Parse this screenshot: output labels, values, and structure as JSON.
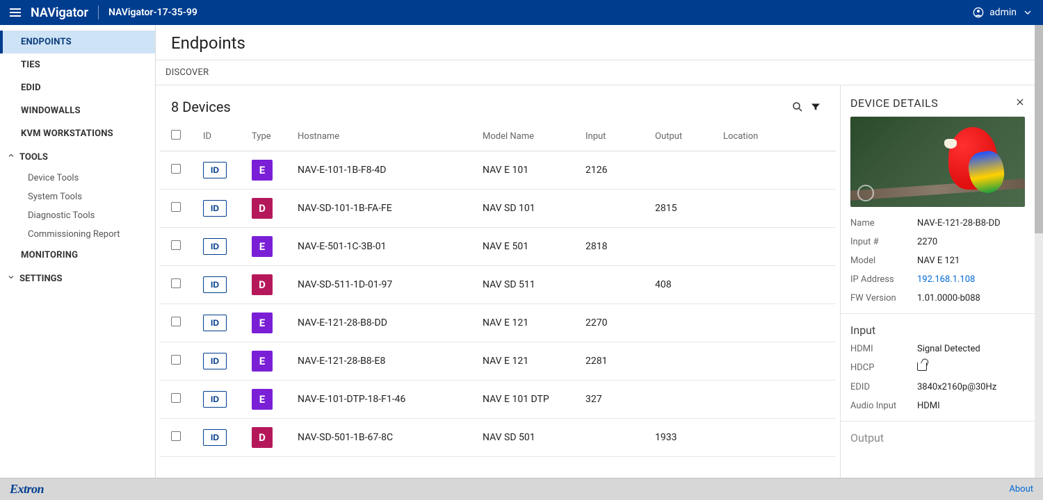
{
  "header": {
    "brand": "NAVigator",
    "device": "NAVigator-17-35-99",
    "user": "admin"
  },
  "sidebar": {
    "items": [
      "ENDPOINTS",
      "TIES",
      "EDID",
      "WINDOWALLS",
      "KVM WORKSTATIONS"
    ],
    "tools_label": "TOOLS",
    "tools": [
      "Device Tools",
      "System Tools",
      "Diagnostic Tools",
      "Commissioning Report"
    ],
    "monitoring": "MONITORING",
    "settings": "SETTINGS",
    "active": 0
  },
  "page": {
    "title": "Endpoints",
    "tab_discover": "DISCOVER",
    "count_label": "8 Devices"
  },
  "columns": {
    "id": "ID",
    "type": "Type",
    "hostname": "Hostname",
    "model": "Model Name",
    "input": "Input",
    "output": "Output",
    "location": "Location"
  },
  "id_button_label": "ID",
  "rows": [
    {
      "type": "E",
      "hostname": "NAV-E-101-1B-F8-4D",
      "model": "NAV E 101",
      "input": "2126",
      "output": "",
      "location": ""
    },
    {
      "type": "D",
      "hostname": "NAV-SD-101-1B-FA-FE",
      "model": "NAV SD 101",
      "input": "",
      "output": "2815",
      "location": ""
    },
    {
      "type": "E",
      "hostname": "NAV-E-501-1C-3B-01",
      "model": "NAV E 501",
      "input": "2818",
      "output": "",
      "location": ""
    },
    {
      "type": "D",
      "hostname": "NAV-SD-511-1D-01-97",
      "model": "NAV SD 511",
      "input": "",
      "output": "408",
      "location": ""
    },
    {
      "type": "E",
      "hostname": "NAV-E-121-28-B8-DD",
      "model": "NAV E 121",
      "input": "2270",
      "output": "",
      "location": ""
    },
    {
      "type": "E",
      "hostname": "NAV-E-121-28-B8-E8",
      "model": "NAV E 121",
      "input": "2281",
      "output": "",
      "location": ""
    },
    {
      "type": "E",
      "hostname": "NAV-E-101-DTP-18-F1-46",
      "model": "NAV E 101 DTP",
      "input": "327",
      "output": "",
      "location": ""
    },
    {
      "type": "D",
      "hostname": "NAV-SD-501-1B-67-8C",
      "model": "NAV SD 501",
      "input": "",
      "output": "1933",
      "location": ""
    }
  ],
  "details": {
    "title": "DEVICE DETAILS",
    "labels": {
      "name": "Name",
      "input_no": "Input #",
      "model": "Model",
      "ip": "IP Address",
      "fw": "FW Version",
      "input_section": "Input",
      "hdmi": "HDMI",
      "hdcp": "HDCP",
      "edid": "EDID",
      "audio": "Audio Input",
      "output_section": "Output"
    },
    "values": {
      "name": "NAV-E-121-28-B8-DD",
      "input_no": "2270",
      "model": "NAV E 121",
      "ip": "192.168.1.108",
      "fw": "1.01.0000-b088",
      "hdmi": "Signal Detected",
      "edid": "3840x2160p@30Hz",
      "audio": "HDMI"
    }
  },
  "footer": {
    "logo": "Extron",
    "about": "About"
  }
}
